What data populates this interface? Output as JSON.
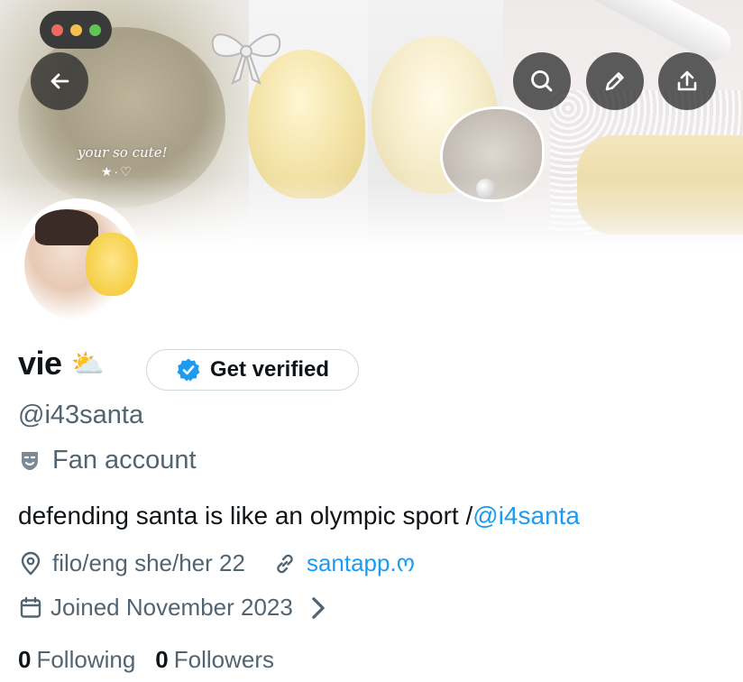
{
  "window": {
    "controls": [
      "close",
      "minimize",
      "maximize"
    ],
    "dot_colors": [
      "#ec6a5e",
      "#f4bf4f",
      "#61c554"
    ]
  },
  "banner": {
    "overlay_text": "your so cute!",
    "overlay_marks": "★·♡"
  },
  "toolbar": {
    "back_icon": "arrow-left-icon",
    "search_icon": "search-icon",
    "edit_icon": "pencil-icon",
    "share_icon": "share-upload-icon"
  },
  "profile": {
    "name": "vie",
    "name_emoji": "⛅",
    "verify_label": "Get verified",
    "handle": "@i43santa",
    "category": "Fan account",
    "bio_text": "defending santa is like an olympic sport /",
    "bio_mention": "@i4santa",
    "location": "filo/eng she/her 22",
    "website": "santapp.ო",
    "joined": "Joined November 2023",
    "following_count": "0",
    "following_label": "Following",
    "followers_count": "0",
    "followers_label": "Followers"
  },
  "colors": {
    "accent": "#1d9bf0",
    "muted": "#536471",
    "text": "#0f1419"
  }
}
